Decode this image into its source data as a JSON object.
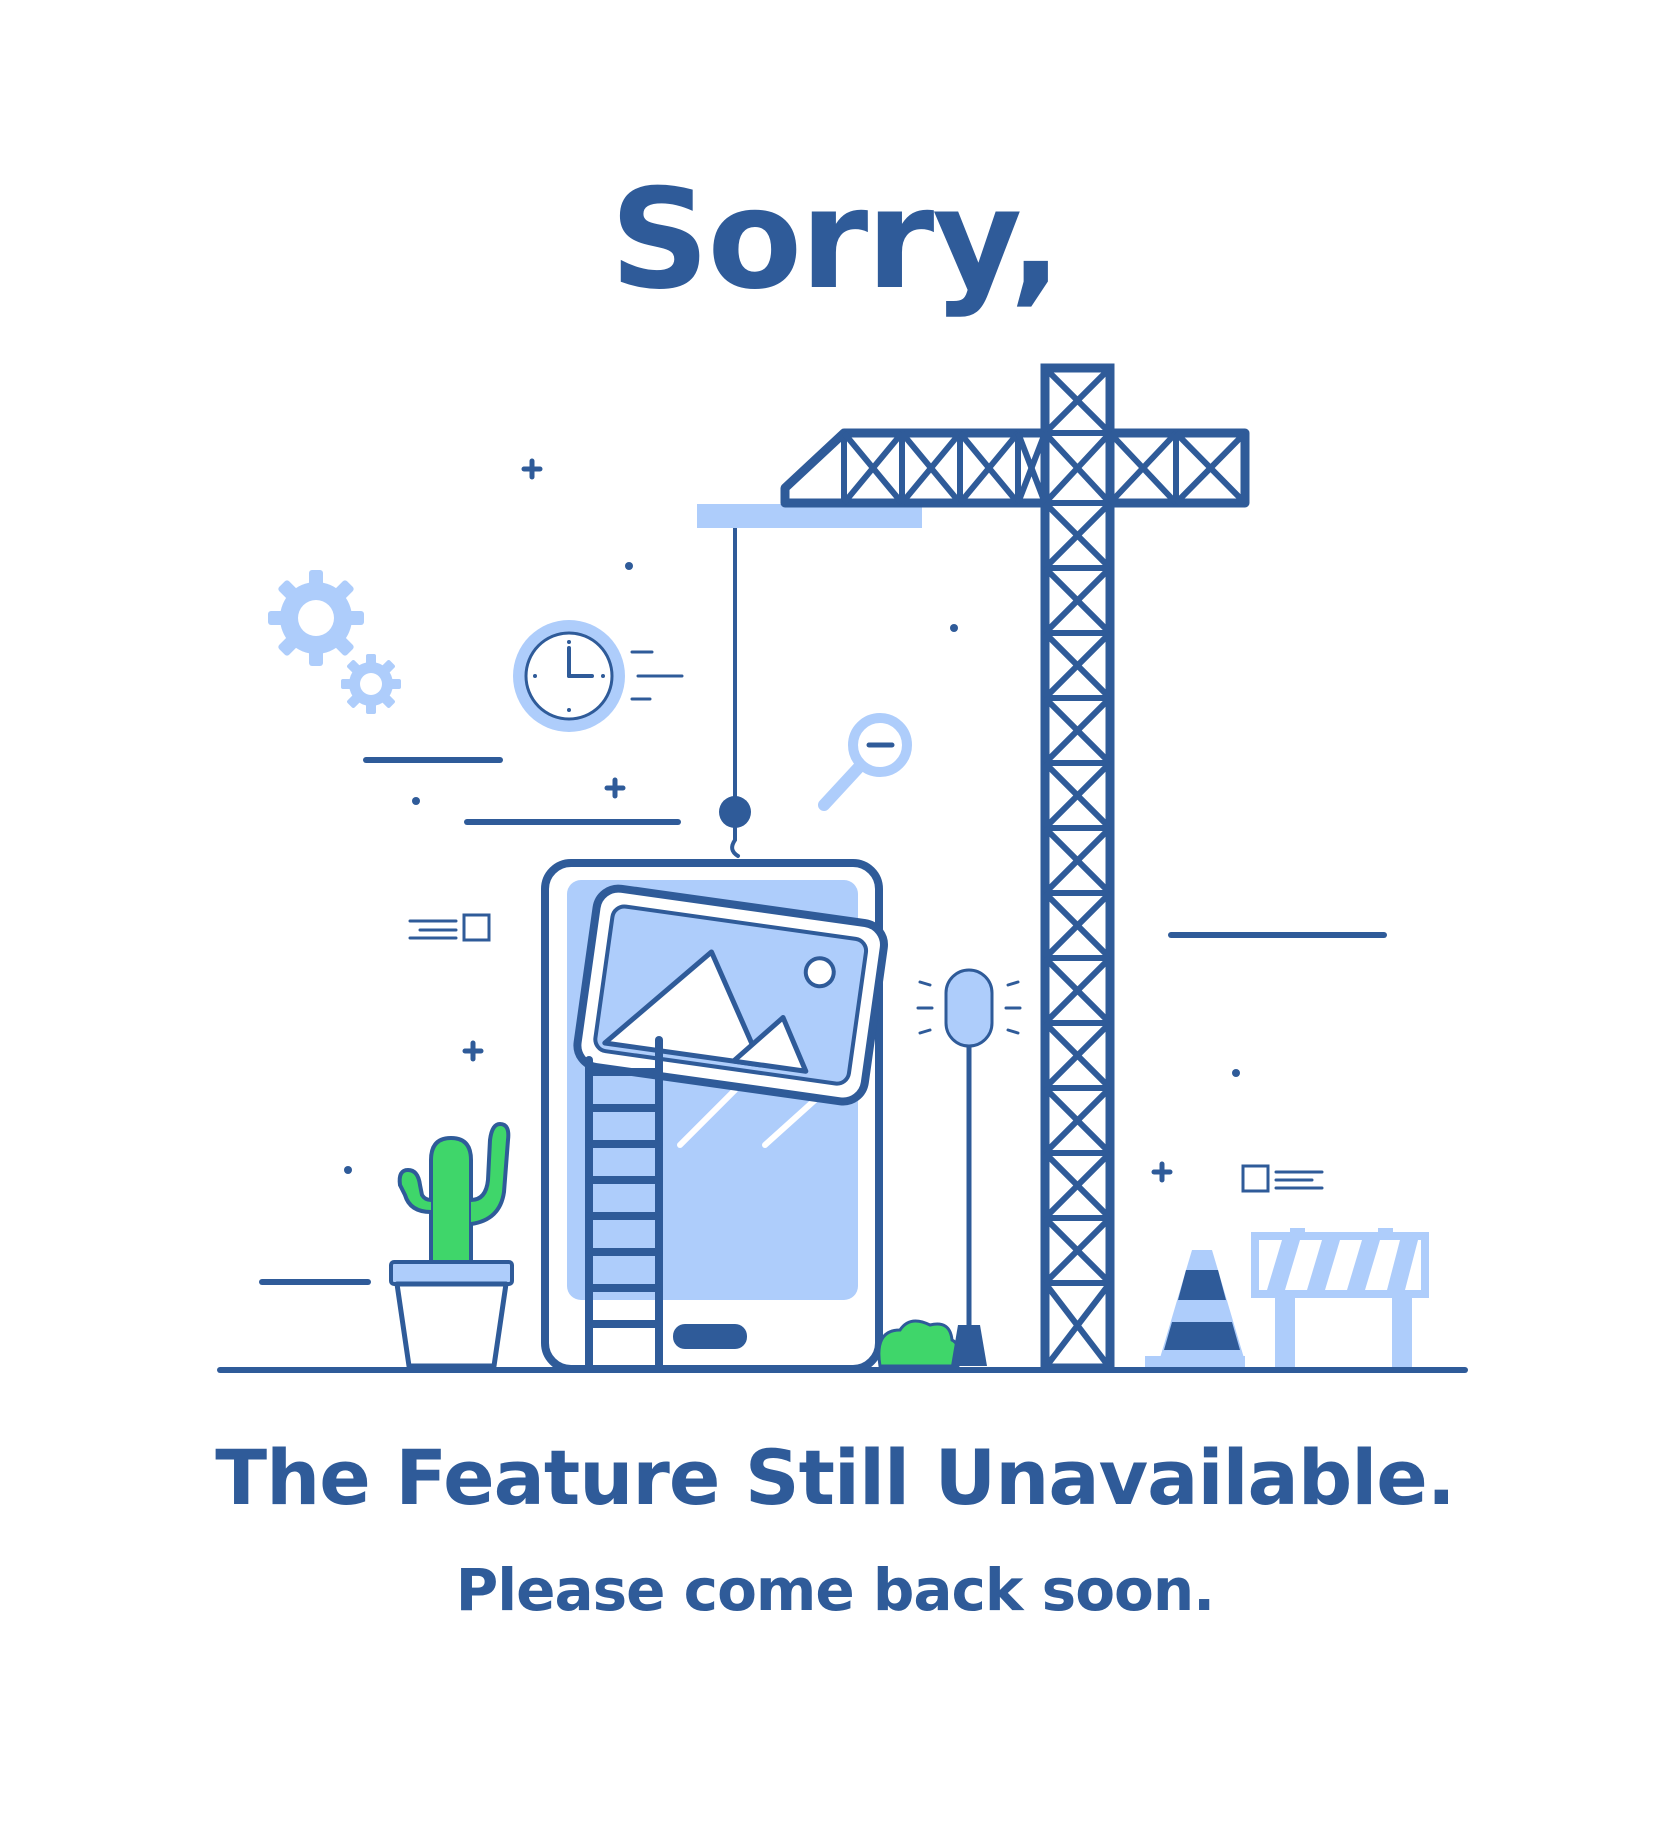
{
  "headline": "Sorry,",
  "message": "The Feature Still Unavailable.",
  "sub_message": "Please come back soon.",
  "colors": {
    "primary_dark_blue": "#2f5b99",
    "light_blue": "#aecdfb",
    "cactus_green": "#3fd66a",
    "background": "#ffffff"
  },
  "illustration": {
    "items": [
      "tower-crane",
      "smartphone",
      "picture-card",
      "ladder",
      "cactus-pot",
      "street-lamp",
      "traffic-cone",
      "road-barrier",
      "gears",
      "clock",
      "magnifier",
      "bush"
    ]
  }
}
